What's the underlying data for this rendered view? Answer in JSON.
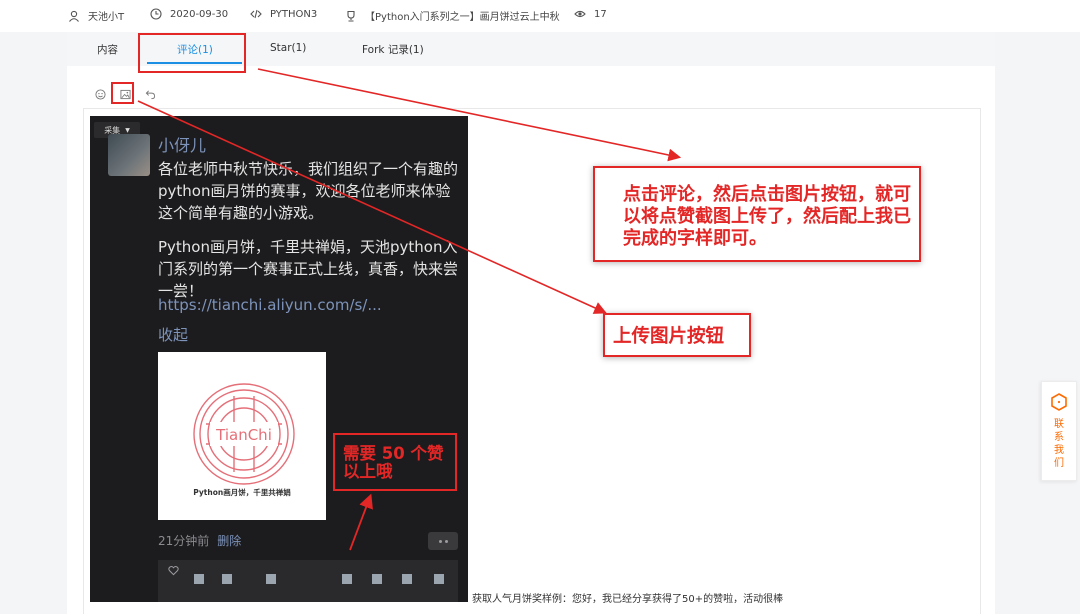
{
  "meta": {
    "author": "天池小T",
    "date": "2020-09-30",
    "language": "PYTHON3",
    "competition": "【Python入门系列之一】画月饼过云上中秋",
    "views": "17"
  },
  "tabs": [
    {
      "label": "内容"
    },
    {
      "label": "评论(1)"
    },
    {
      "label": "Star(1)"
    },
    {
      "label": "Fork 记录(1)"
    }
  ],
  "screenshot": {
    "collect_label": "采集",
    "user_name": "小伢儿",
    "paragraph1": "各位老师中秋节快乐，我们组织了一个有趣的python画月饼的赛事，欢迎各位老师来体验这个简单有趣的小游戏。",
    "paragraph2": "Python画月饼，千里共禅娟，天池python入门系列的第一个赛事正式上线，真香，快来尝一尝！",
    "link": "https://tianchi.aliyun.com/s/...",
    "collapse": "收起",
    "poster_logo": "TianChi",
    "poster_caption": "Python画月饼，千里共禅娟",
    "time_ago": "21分钟前",
    "delete": "删除"
  },
  "comment_text": "获取人气月饼奖样例：您好，我已经分享获得了50+的赞啦，活动很棒",
  "annotations": {
    "note1": "点击评论，然后点击图片按钮，就可以将点赞截图上传了，然后配上我已完成的字样即可。",
    "note2": "上传图片按钮",
    "note3": "需要 50 个赞以上哦"
  },
  "contact": {
    "label": "联系我们"
  },
  "colors": {
    "accent": "#1a8fe3",
    "annotation": "#e32626",
    "contact": "#ff6a00"
  }
}
